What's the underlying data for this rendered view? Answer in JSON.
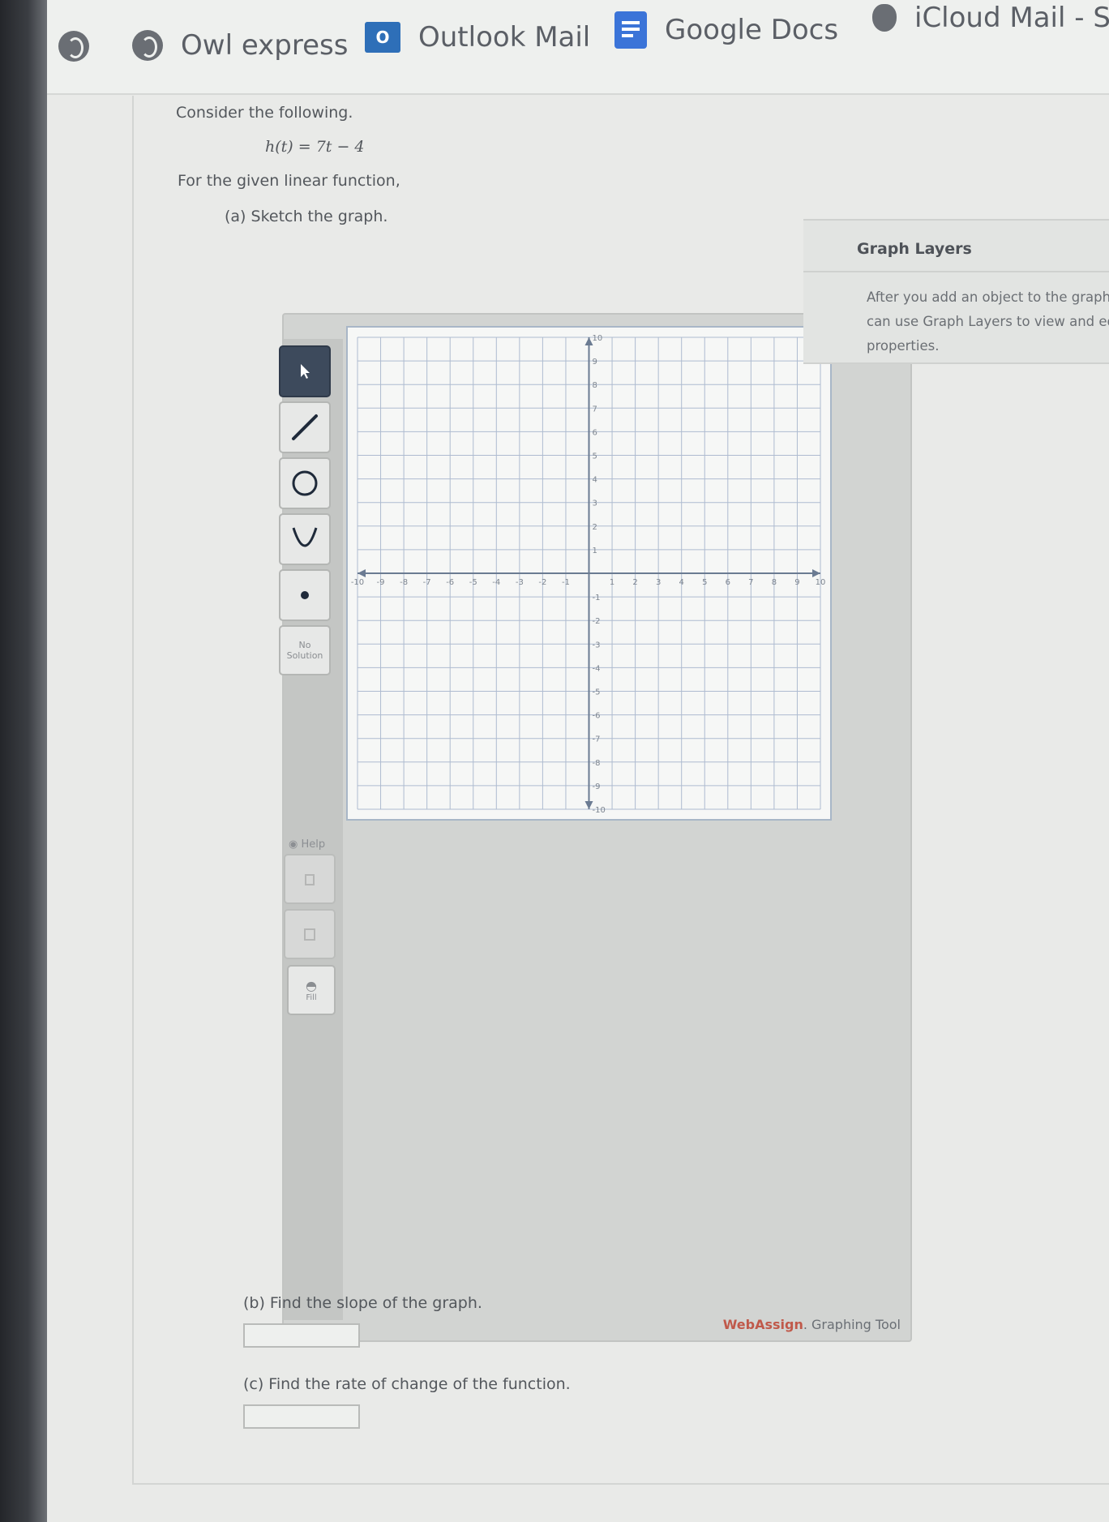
{
  "bookmarks": [
    {
      "label": "",
      "icon": "globe-icon"
    },
    {
      "label": "Owl express",
      "icon": "globe-icon"
    },
    {
      "label": "Outlook Mail",
      "icon": "outlook-icon"
    },
    {
      "label": "Google Docs",
      "icon": "google-docs-icon"
    },
    {
      "label": "iCloud Mail - Se",
      "icon": "apple-icon"
    }
  ],
  "outlook_badge": "O",
  "problem": {
    "intro": "Consider the following.",
    "function": "h(t) = 7t − 4",
    "instruction": "For the given linear function,",
    "part_a": "(a) Sketch the graph.",
    "part_b": "(b) Find the slope of the graph.",
    "part_c": "(c) Find the rate of change of the function."
  },
  "toolbar": {
    "no_solution": "No Solution",
    "help": "Help",
    "fill": "Fill"
  },
  "graph": {
    "x_range": [
      -10,
      10
    ],
    "y_range": [
      -10,
      10
    ],
    "grid": true,
    "minor_per_unit": 1
  },
  "brand": {
    "name": "WebAssign",
    "suffix": ". Graphing Tool"
  },
  "layers": {
    "title": "Graph Layers",
    "collapse": "«",
    "message": "After you add an object to the graph you can use Graph Layers to view and edit its properties."
  },
  "answers": {
    "slope": "",
    "rate": ""
  }
}
